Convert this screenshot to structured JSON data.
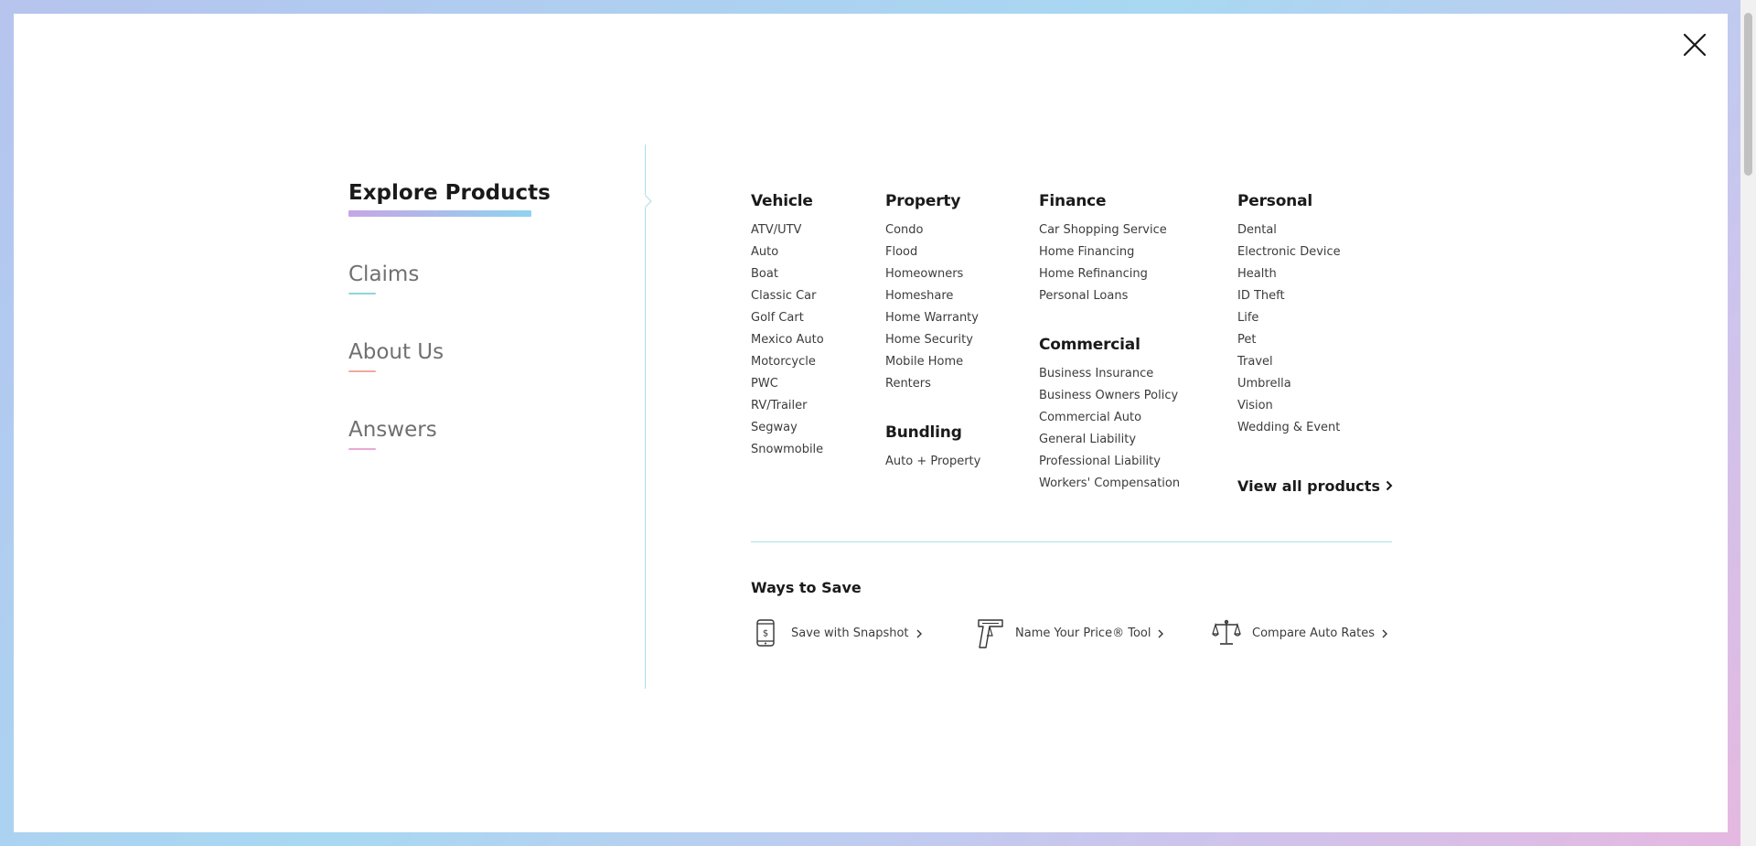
{
  "close": {
    "icon": "close-icon"
  },
  "leftnav": {
    "items": [
      {
        "label": "Explore Products",
        "active": true,
        "underline": "#b9a3e0"
      },
      {
        "label": "Claims",
        "active": false,
        "underline": "#8fd6d8"
      },
      {
        "label": "About Us",
        "active": false,
        "underline": "#f3a8a0"
      },
      {
        "label": "Answers",
        "active": false,
        "underline": "#e9a8d6"
      }
    ]
  },
  "menu": {
    "vehicle": {
      "title": "Vehicle",
      "items": [
        "ATV/UTV",
        "Auto",
        "Boat",
        "Classic Car",
        "Golf Cart",
        "Mexico Auto",
        "Motorcycle",
        "PWC",
        "RV/Trailer",
        "Segway",
        "Snowmobile"
      ]
    },
    "property": {
      "title": "Property",
      "items": [
        "Condo",
        "Flood",
        "Homeowners",
        "Homeshare",
        "Home Warranty",
        "Home Security",
        "Mobile Home",
        "Renters"
      ]
    },
    "bundling": {
      "title": "Bundling",
      "items": [
        "Auto + Property"
      ]
    },
    "finance": {
      "title": "Finance",
      "items": [
        "Car Shopping Service",
        "Home Financing",
        "Home Refinancing",
        "Personal Loans"
      ]
    },
    "commercial": {
      "title": "Commercial",
      "items": [
        "Business Insurance",
        "Business Owners Policy",
        "Commercial Auto",
        "General Liability",
        "Professional Liability",
        "Workers' Compensation"
      ]
    },
    "personal": {
      "title": "Personal",
      "items": [
        "Dental",
        "Electronic Device",
        "Health",
        "ID Theft",
        "Life",
        "Pet",
        "Travel",
        "Umbrella",
        "Vision",
        "Wedding & Event"
      ]
    },
    "view_all": "View all products"
  },
  "ways_to_save": {
    "title": "Ways to Save",
    "links": [
      {
        "label": "Save with Snapshot",
        "icon": "phone-dollar-icon"
      },
      {
        "label": "Name Your Price® Tool",
        "icon": "price-gun-icon"
      },
      {
        "label": "Compare Auto Rates",
        "icon": "scales-icon"
      }
    ]
  },
  "colors": {
    "accent_line": "#a9dfe3",
    "active_underline_start": "#c6a6e6",
    "active_underline_end": "#8fd3f0"
  }
}
